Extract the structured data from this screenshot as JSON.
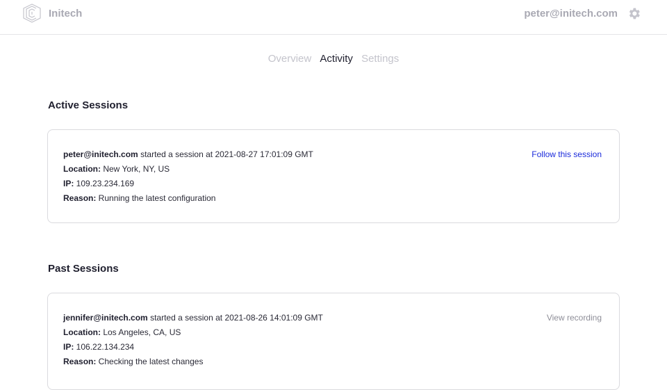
{
  "header": {
    "brand": "Initech",
    "user_email": "peter@initech.com",
    "logo_icon": "initech-logo-icon",
    "settings_icon": "gear-icon"
  },
  "tabs": [
    {
      "label": "Overview",
      "active": false
    },
    {
      "label": "Activity",
      "active": true
    },
    {
      "label": "Settings",
      "active": false
    }
  ],
  "active_sessions": {
    "title": "Active Sessions",
    "items": [
      {
        "user": "peter@initech.com",
        "started_text": " started a session at 2021-08-27 17:01:09 GMT",
        "location_label": "Location:",
        "location": " New York, NY, US",
        "ip_label": "IP:",
        "ip": " 109.23.234.169",
        "reason_label": "Reason:",
        "reason": " Running the latest configuration",
        "action": "Follow this session"
      }
    ]
  },
  "past_sessions": {
    "title": "Past Sessions",
    "items": [
      {
        "user": "jennifer@initech.com",
        "started_text": " started a session at 2021-08-26 14:01:09 GMT",
        "location_label": "Location:",
        "location": " Los Angeles, CA, US",
        "ip_label": "IP:",
        "ip": " 106.22.134.234",
        "reason_label": "Reason:",
        "reason": " Checking the latest changes",
        "action": "View recording"
      }
    ]
  },
  "colors": {
    "accent_link": "#1a2adb",
    "muted_link": "#8e8e98",
    "muted_header": "#a9a9b3"
  }
}
